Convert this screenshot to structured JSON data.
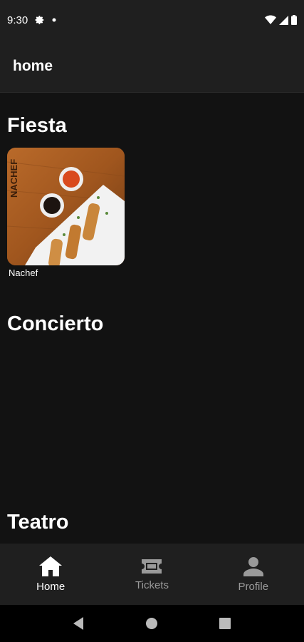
{
  "status_bar": {
    "time": "9:30",
    "icons": [
      "gear-icon",
      "dot-icon",
      "wifi-icon",
      "signal-icon",
      "battery-icon"
    ]
  },
  "app_bar": {
    "title": "home"
  },
  "sections": [
    {
      "title": "Fiesta",
      "items": [
        {
          "name": "Nachef",
          "logo_text": "NACHEF"
        }
      ]
    },
    {
      "title": "Concierto",
      "items": []
    },
    {
      "title": "Teatro",
      "items": []
    }
  ],
  "bottom_nav": [
    {
      "label": "Home",
      "icon": "home-icon",
      "active": true
    },
    {
      "label": "Tickets",
      "icon": "ticket-icon",
      "active": false
    },
    {
      "label": "Profile",
      "icon": "person-icon",
      "active": false
    }
  ],
  "colors": {
    "background": "#121212",
    "bar_background": "#1f1f1f",
    "active_nav": "#ffffff",
    "inactive_nav": "#9a9a9a"
  }
}
